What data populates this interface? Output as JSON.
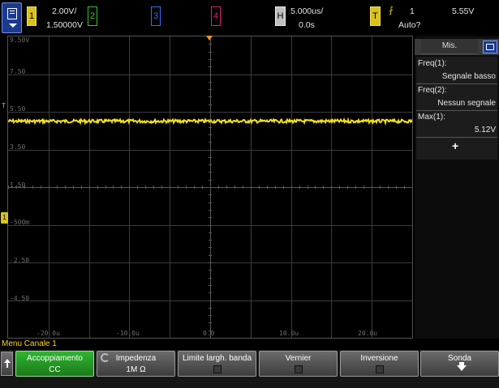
{
  "topbar": {
    "ch1_num": "1",
    "ch1_scale": "2.00V/",
    "ch1_offset": "1.50000V",
    "ch2_num": "2",
    "ch3_num": "3",
    "ch4_num": "4",
    "horiz_label": "H",
    "horiz_scale": "5.000us/",
    "horiz_delay": "0.0s",
    "trig_label": "T",
    "trig_source": "1",
    "trig_level": "5.55V",
    "trig_mode": "Auto?"
  },
  "icons": [
    "menu-icon",
    "trigger-edge-icon",
    "measurement-panel-icon",
    "knob-icon",
    "checkbox-icon",
    "down-arrow-icon",
    "back-arrow-icon"
  ],
  "graticule": {
    "y_labels": [
      "9.50V",
      "7.50",
      "5.50",
      "3.50",
      "1.50",
      "-500m",
      "-2.50",
      "-4.50"
    ],
    "x_labels": [
      "-20.0u",
      "-10.0u",
      "0.0",
      "10.0u",
      "20.0u"
    ],
    "ch1_marker": "1",
    "trig_level_marker": "T"
  },
  "trace": {
    "color": "#f2e01a",
    "level_volts": 5.0
  },
  "measurements": {
    "title": "Mis.",
    "items": [
      {
        "label": "Freq(1):",
        "value": "Segnale basso"
      },
      {
        "label": "Freq(2):",
        "value": "Nessun segnale"
      },
      {
        "label": "Max(1):",
        "value": "5.12V"
      }
    ],
    "add_label": "+"
  },
  "softkeys": {
    "menu_title": "Menu Canale 1",
    "keys": [
      {
        "label": "Accoppiamento",
        "value": "CC"
      },
      {
        "label": "Impedenza",
        "value": "1M Ω"
      },
      {
        "label": "Limite largh. banda",
        "value": ""
      },
      {
        "label": "Vernier",
        "value": ""
      },
      {
        "label": "Inversione",
        "value": ""
      },
      {
        "label": "Sonda",
        "value": ""
      }
    ]
  },
  "colors": {
    "ch1": "#d9c21b",
    "ch2": "#32c832",
    "ch3": "#3b6cff",
    "ch4": "#e01f7a",
    "trigger": "#f29a1a",
    "active_softkey": "#2fb52f"
  }
}
